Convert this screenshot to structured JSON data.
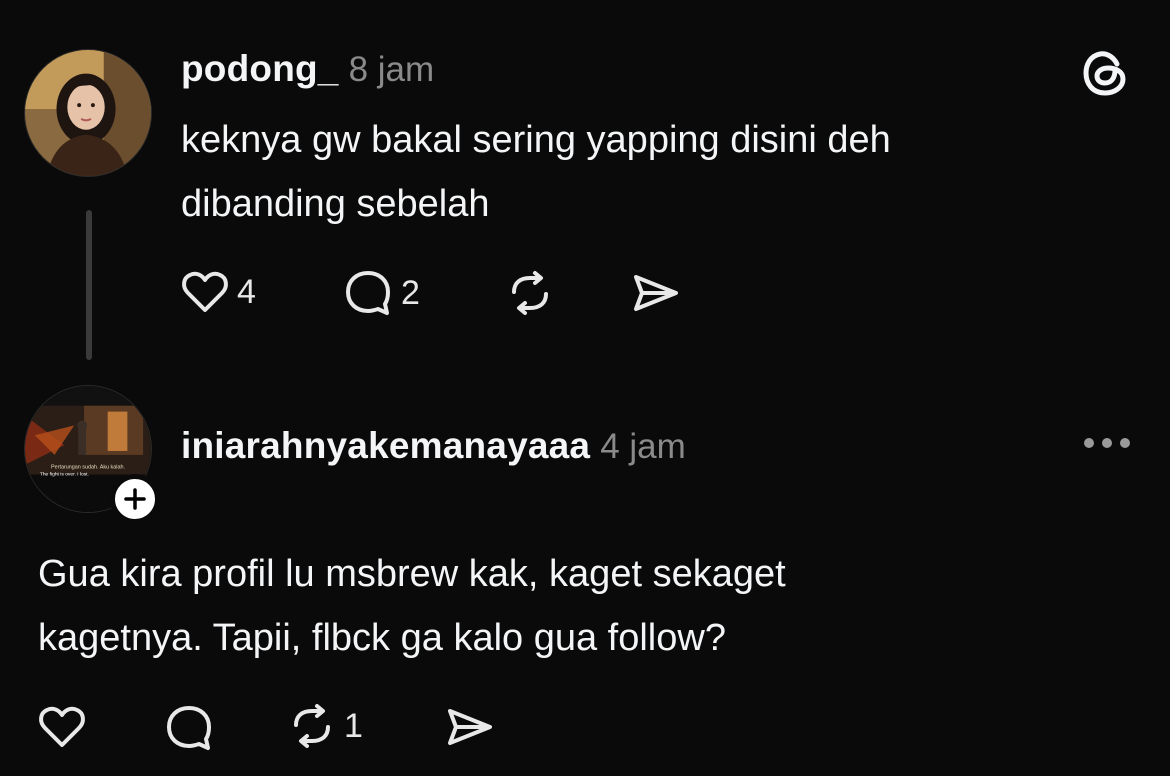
{
  "posts": [
    {
      "username": "podong_",
      "time": "8 jam",
      "text_lines": [
        "keknya gw bakal sering yapping disini deh",
        "dibanding sebelah"
      ],
      "likes": "4",
      "replies": "2",
      "reposts": "",
      "avatar_icon": "profile-photo-woman"
    },
    {
      "username": "iniarahnyakemanayaaa",
      "time": "4 jam",
      "text_lines": [
        "Gua kira profil lu msbrew kak, kaget sekaget",
        "kagetnya. Tapii, flbck ga kalo gua follow?"
      ],
      "likes": "",
      "replies": "",
      "reposts": "1",
      "avatar_icon": "profile-photo-game-scene",
      "avatar_caption_lines": [
        "Pertarungan sudah. Aku kalah.",
        "The fight is over. I lost."
      ]
    }
  ],
  "icons": {
    "threads_logo": "threads-logo-icon",
    "more": "more-horizontal-icon",
    "follow": "plus-icon",
    "like": "heart-icon",
    "reply": "comment-icon",
    "repost": "repost-icon",
    "share": "send-icon"
  },
  "colors": {
    "background": "#0a0a0a",
    "text": "#f3f5f7",
    "secondary": "#8a8a8a"
  }
}
